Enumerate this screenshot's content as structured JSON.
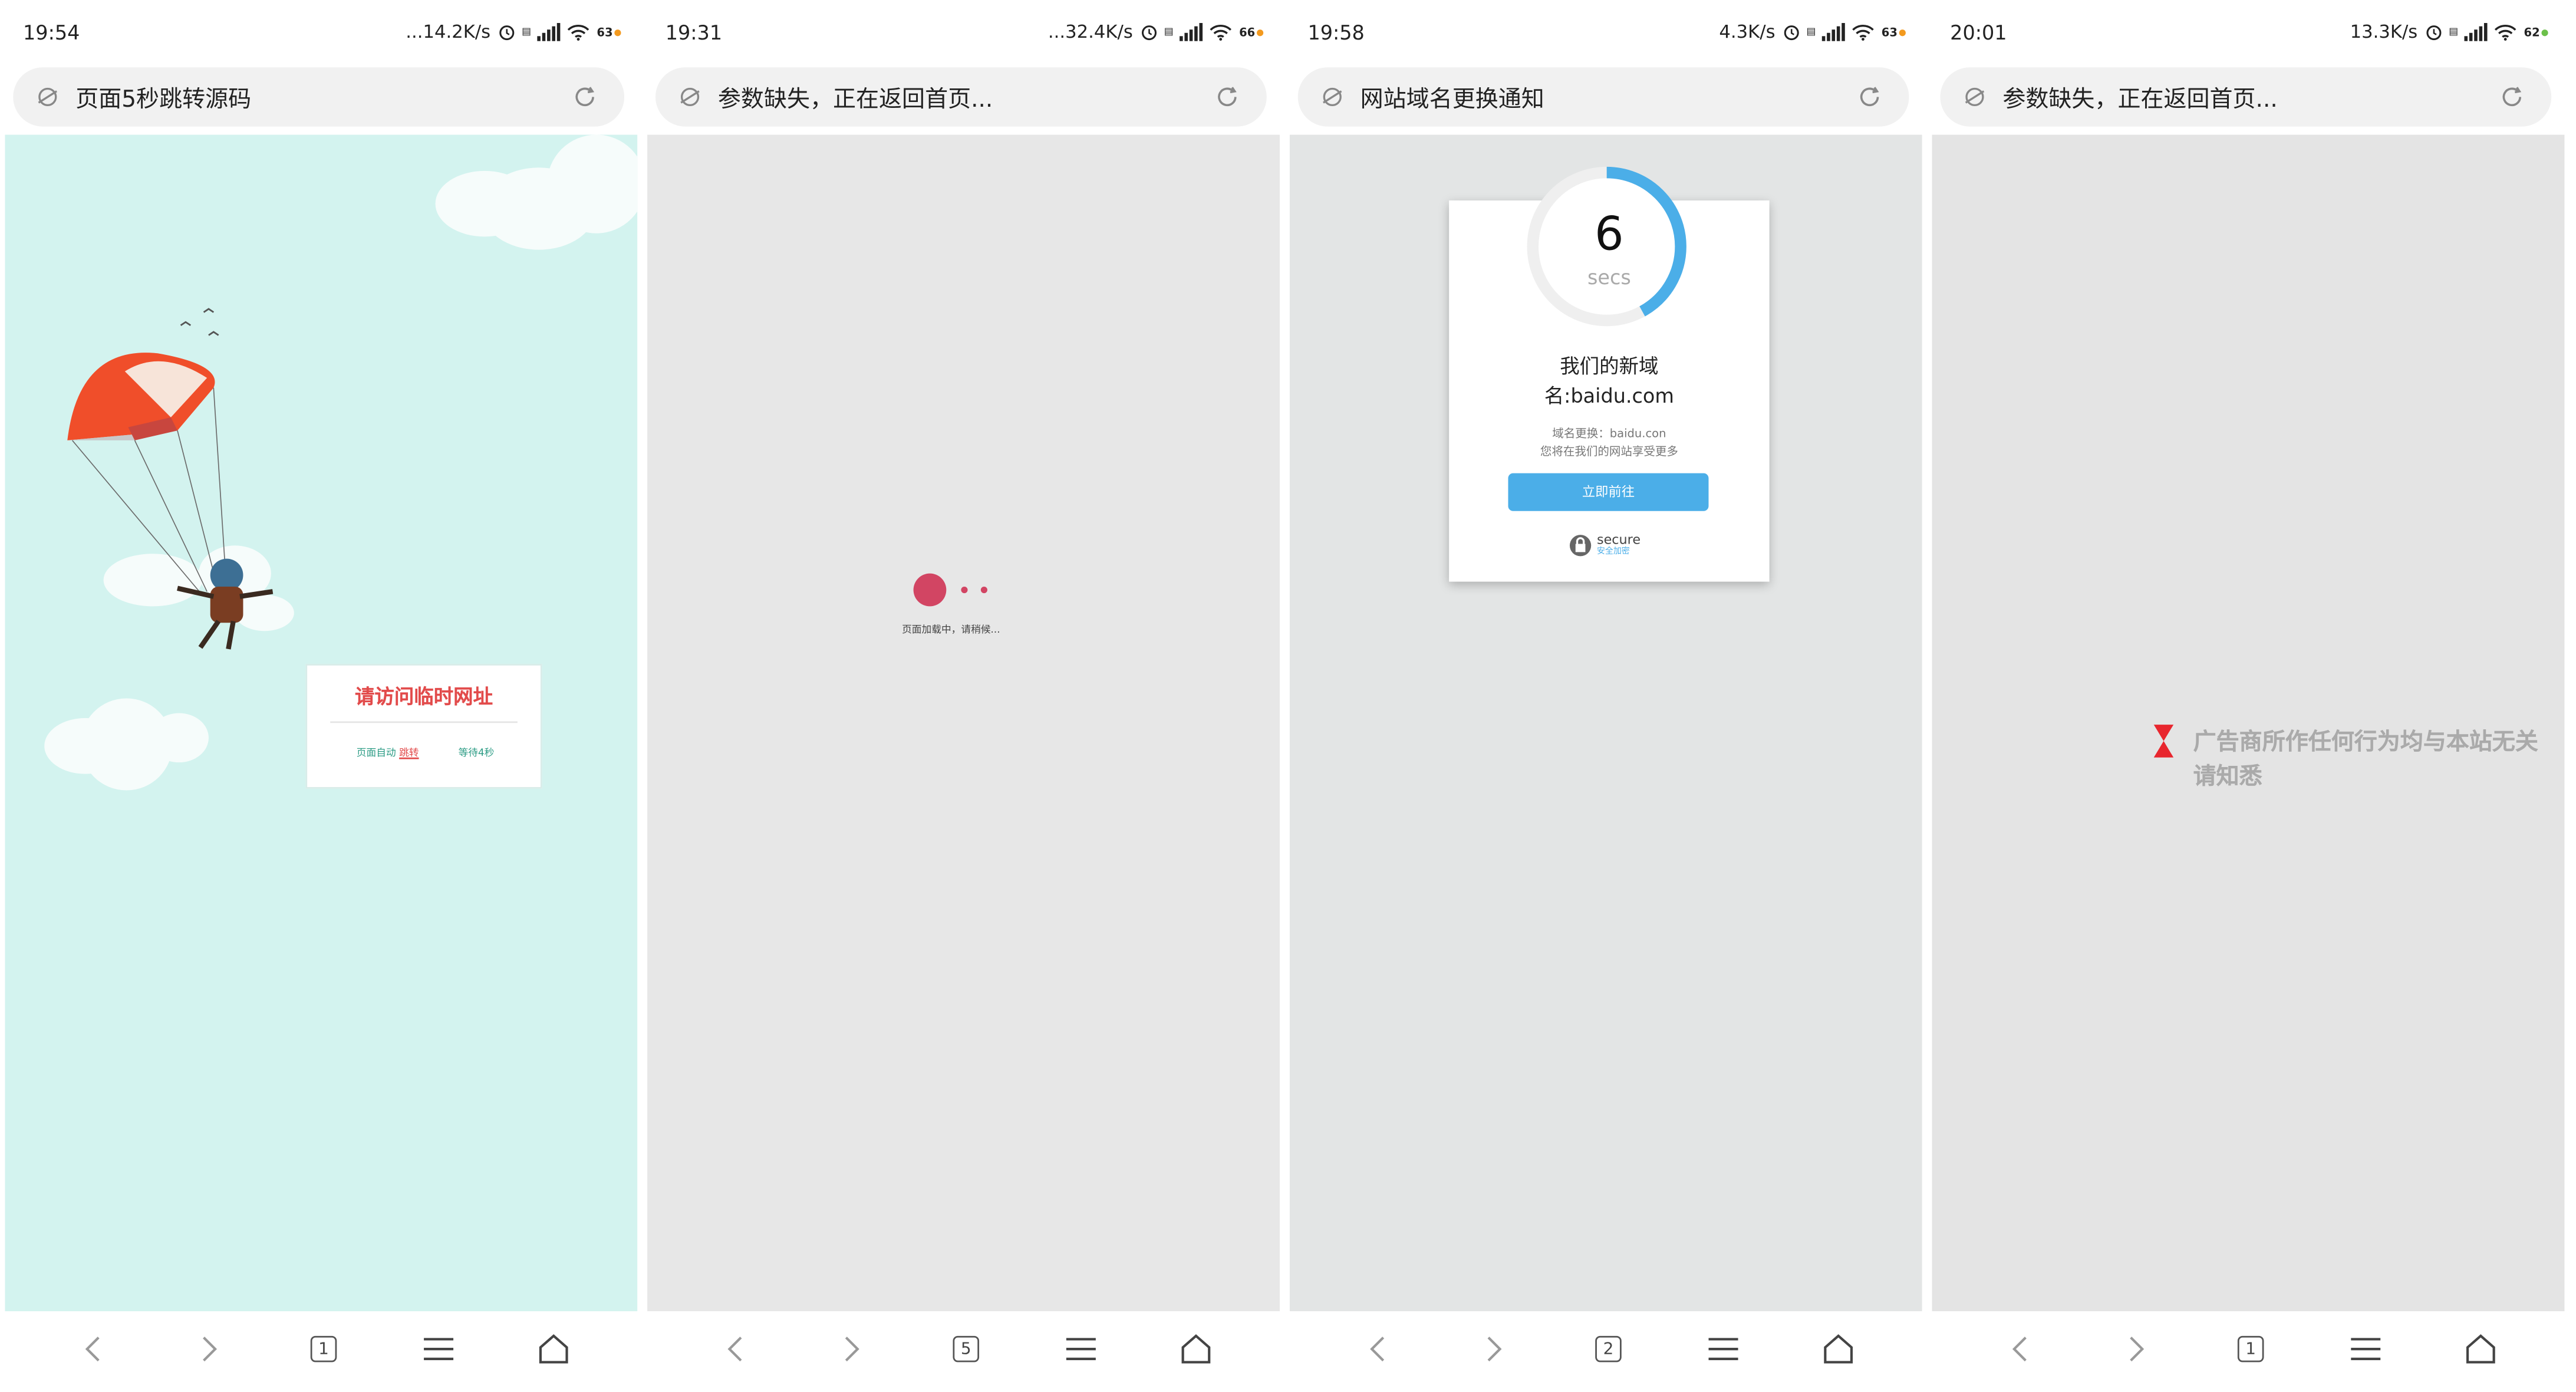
{
  "phones": [
    {
      "time": "19:54",
      "net_speed": "...14.2K/s",
      "battery": "63",
      "address": "页面5秒跳转源码",
      "tab_count": "1",
      "page": {
        "notice_title": "请访问临时网址",
        "auto_text": "页面自动",
        "jump_text": "跳转",
        "wait_text": "等待4秒"
      }
    },
    {
      "time": "19:31",
      "net_speed": "...32.4K/s",
      "battery": "66",
      "address": "参数缺失，正在返回首页...",
      "tab_count": "5",
      "page": {
        "loading_text": "页面加载中，请稍候..."
      }
    },
    {
      "time": "19:58",
      "net_speed": "4.3K/s",
      "battery": "63",
      "address": "网站域名更换通知",
      "tab_count": "2",
      "page": {
        "countdown": "6",
        "countdown_unit": "secs",
        "countdown_progress": 0.42,
        "domain_line1": "我们的新域",
        "domain_line2": "名:baidu.com",
        "change_text": "域名更换：baidu.con",
        "enjoy_text": "您将在我们的网站享受更多",
        "go_button": "立即前往",
        "secure_label": "secure",
        "secure_sub": "安全加密"
      }
    },
    {
      "time": "20:01",
      "net_speed": "13.3K/s",
      "battery": "62",
      "address": "参数缺失，正在返回首页...",
      "tab_count": "1",
      "page": {
        "ad_line1": "广告商所作任何行为均与本站无关",
        "ad_line2": "请知悉"
      }
    }
  ],
  "colors": {
    "sky": "#d3f3ef",
    "notice_red": "#e24b4b",
    "loader": "#d24563",
    "accent_blue": "#4baee8",
    "ad_icon_red": "#e8262e"
  },
  "icons": [
    "globe-icon",
    "refresh-icon",
    "back-icon",
    "forward-icon",
    "tabs-icon",
    "menu-icon",
    "home-icon",
    "alarm-icon",
    "signal-icon",
    "wifi-icon",
    "battery-icon"
  ]
}
